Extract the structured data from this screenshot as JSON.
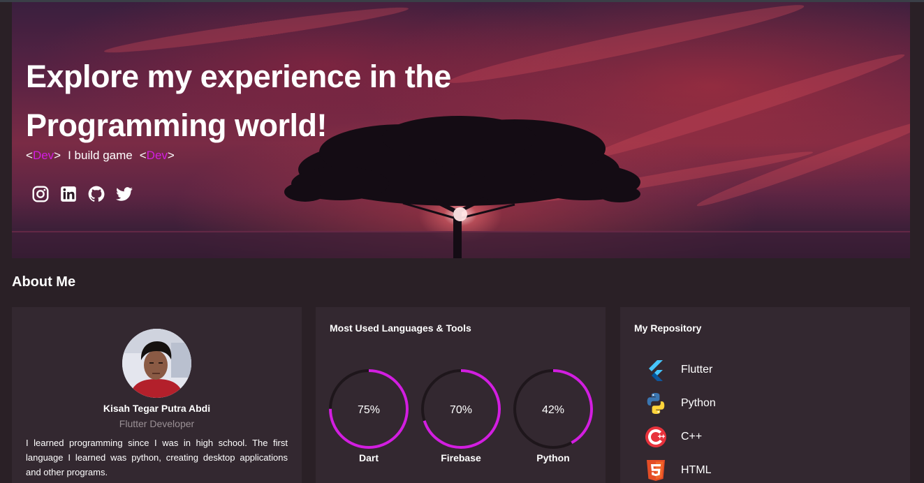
{
  "hero": {
    "title_line1": "Explore my experience in the",
    "title_line2": "Programming world!",
    "tag_left_open": "<",
    "tag_left_word": "Dev",
    "tag_left_close": ">",
    "tag_text": "I build game",
    "tag_right_open": "<",
    "tag_right_word": "Dev",
    "tag_right_close": ">",
    "accent_color": "#d21ee0",
    "socials": [
      {
        "icon": "instagram-icon"
      },
      {
        "icon": "linkedin-icon"
      },
      {
        "icon": "github-icon"
      },
      {
        "icon": "twitter-icon"
      }
    ]
  },
  "about": {
    "title": "About Me",
    "profile": {
      "name": "Kisah Tegar Putra Abdi",
      "role": "Flutter Developer",
      "bio": "I learned programming since I was in high school. The first language I learned was python, creating desktop applications and other programs."
    },
    "tools": {
      "title": "Most Used Languages & Tools",
      "ring_color": "#d21ee0",
      "items": [
        {
          "name": "Dart",
          "percent": 75,
          "label": "75%"
        },
        {
          "name": "Firebase",
          "percent": 70,
          "label": "70%"
        },
        {
          "name": "Python",
          "percent": 42,
          "label": "42%"
        }
      ]
    },
    "repos": {
      "title": "My Repository",
      "items": [
        {
          "name": "Flutter",
          "icon": "flutter-icon"
        },
        {
          "name": "Python",
          "icon": "python-icon"
        },
        {
          "name": "C++",
          "icon": "cpp-icon"
        },
        {
          "name": "HTML",
          "icon": "html5-icon"
        }
      ]
    }
  }
}
